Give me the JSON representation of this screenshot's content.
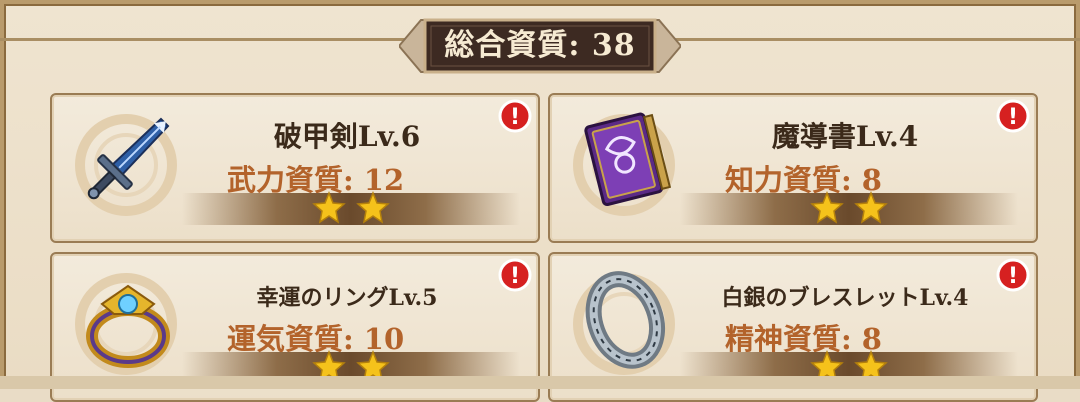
{
  "banner": {
    "label": "総合資質: 38"
  },
  "cards": [
    {
      "title": "破甲剣Lv.6",
      "stat": "武力資質: 12",
      "stars": 2,
      "icon": "sword-icon",
      "alert": "!"
    },
    {
      "title": "魔導書Lv.4",
      "stat": "知力資質: 8",
      "stars": 2,
      "icon": "spellbook-icon",
      "alert": "!"
    },
    {
      "title": "幸運のリングLv.5",
      "stat": "運気資質: 10",
      "stars": 2,
      "icon": "ring-icon",
      "alert": "!"
    },
    {
      "title": "白銀のブレスレットLv.4",
      "stat": "精神資質: 8",
      "stars": 2,
      "icon": "bracelet-icon",
      "alert": "!"
    }
  ],
  "colors": {
    "accent": "#b3632b",
    "title": "#3b2a1a",
    "alert": "#d62020",
    "star": "#f5c21b"
  }
}
